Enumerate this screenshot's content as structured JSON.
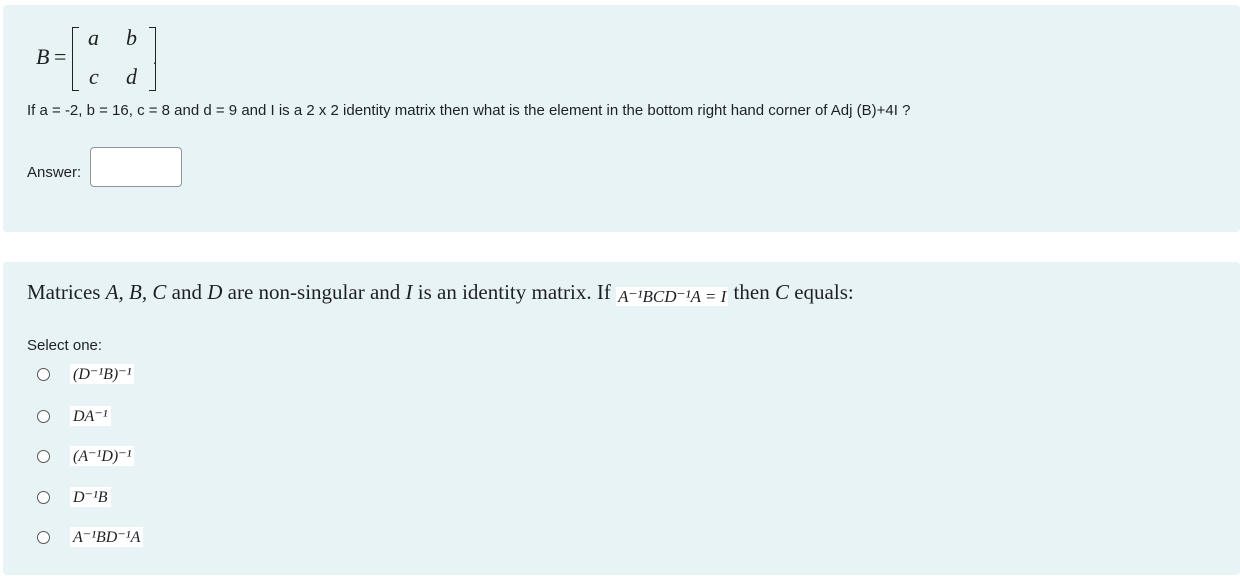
{
  "question1": {
    "matrix_name": "B",
    "matrix_equals": "=",
    "matrix_cells": {
      "a": "a",
      "b": "b",
      "c": "c",
      "d": "d"
    },
    "matrix_trailing": ".",
    "text": "If a = -2, b = 16, c = 8 and d = 9 and I is a 2 x 2 identity matrix then what is the element in the bottom right hand corner of Adj (B)+4I ?",
    "answer_label": "Answer:",
    "answer_value": ""
  },
  "question2": {
    "text_prefix": "Matrices ",
    "text_vars": "A, B, C",
    "text_and": " and ",
    "text_var_d": "D",
    "text_mid": " are non-singular and ",
    "text_var_i": "I",
    "text_mid2": " is an identity matrix. If ",
    "formula": "A⁻¹BCD⁻¹A = I",
    "text_then": " then ",
    "text_var_c": "C",
    "text_suffix": " equals:",
    "select_label": "Select one:",
    "options": [
      {
        "label": "(D⁻¹B)⁻¹"
      },
      {
        "label": "DA⁻¹"
      },
      {
        "label": "(A⁻¹D)⁻¹"
      },
      {
        "label": "D⁻¹B"
      },
      {
        "label": "A⁻¹BD⁻¹A"
      }
    ]
  }
}
